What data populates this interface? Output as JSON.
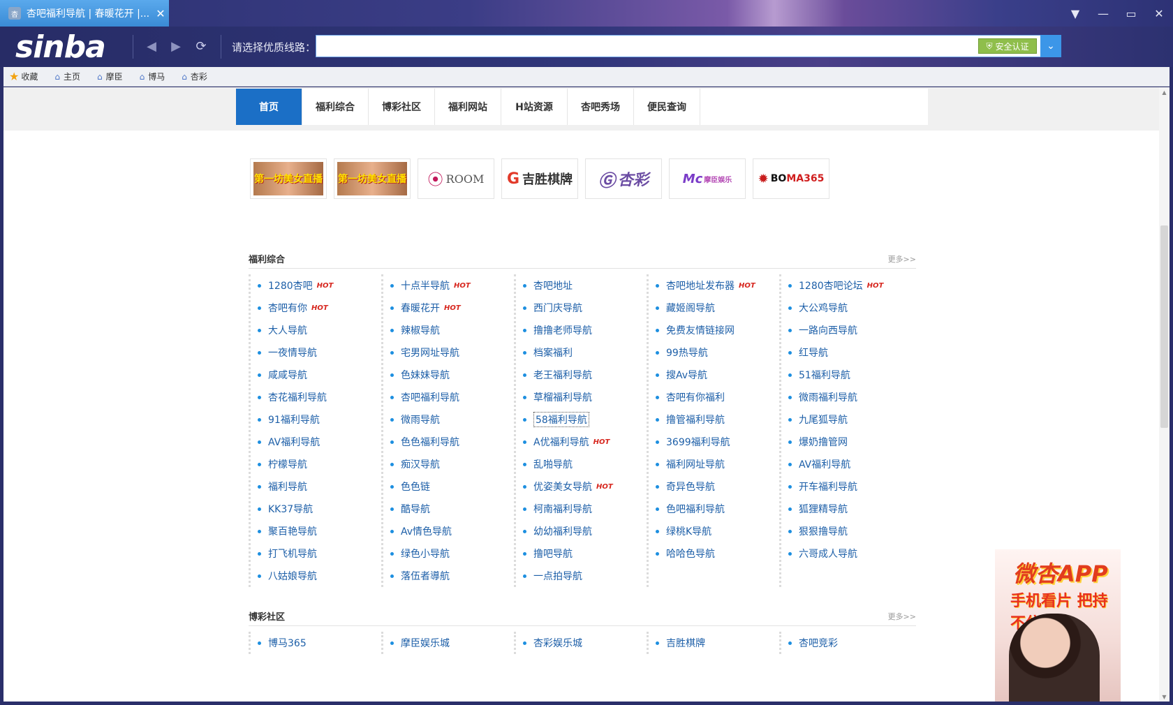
{
  "window": {
    "tab_title": "杏吧福利导航 | 春暖花开 |...",
    "favicon_text": "杏"
  },
  "browser": {
    "logo": "sinba",
    "line_label": "请选择优质线路：",
    "address_value": "",
    "secure_badge": "安全认证"
  },
  "favorites": [
    {
      "label": "收藏",
      "icon": "star-icon"
    },
    {
      "label": "主页",
      "icon": "home-icon"
    },
    {
      "label": "摩臣",
      "icon": "home-icon"
    },
    {
      "label": "博马",
      "icon": "home-icon"
    },
    {
      "label": "杏彩",
      "icon": "home-icon"
    }
  ],
  "nav": [
    "首页",
    "福利综合",
    "博彩社区",
    "福利网站",
    "H站资源",
    "杏吧秀场",
    "便民查询"
  ],
  "ads": {
    "live1": "第一坊美女直播",
    "live2": "第一坊美女直播",
    "room": "ROOM",
    "jisheng": "吉胜棋牌",
    "xingcai": "杏彩",
    "mochen": "摩臣娱乐",
    "boma_a": "BO",
    "boma_b": "MA365"
  },
  "section1": {
    "title": "福利综合",
    "more": "更多>>",
    "hot_label": "HOT",
    "columns": [
      [
        {
          "t": "1280杏吧",
          "hot": true
        },
        {
          "t": "杏吧有你",
          "hot": true
        },
        {
          "t": "大人导航"
        },
        {
          "t": "一夜情导航"
        },
        {
          "t": "咸咸导航"
        },
        {
          "t": "杏花福利导航"
        },
        {
          "t": "91福利导航"
        },
        {
          "t": "AV福利导航"
        },
        {
          "t": "柠檬导航"
        },
        {
          "t": "福利导航"
        },
        {
          "t": "KK37导航"
        },
        {
          "t": "聚百艳导航"
        },
        {
          "t": "打飞机导航"
        },
        {
          "t": "八姑娘导航"
        }
      ],
      [
        {
          "t": "十点半导航",
          "hot": true
        },
        {
          "t": "春暖花开",
          "hot": true
        },
        {
          "t": "辣椒导航"
        },
        {
          "t": "宅男网址导航"
        },
        {
          "t": "色妹妹导航"
        },
        {
          "t": "杏吧福利导航"
        },
        {
          "t": "微雨导航"
        },
        {
          "t": "色色福利导航"
        },
        {
          "t": "痴汉导航"
        },
        {
          "t": "色色链"
        },
        {
          "t": "酷导航"
        },
        {
          "t": "Av情色导航"
        },
        {
          "t": "绿色小导航"
        },
        {
          "t": "落伍者導航"
        }
      ],
      [
        {
          "t": "杏吧地址"
        },
        {
          "t": "西门庆导航"
        },
        {
          "t": "撸撸老师导航"
        },
        {
          "t": "档案福利"
        },
        {
          "t": "老王福利导航"
        },
        {
          "t": "草榴福利导航"
        },
        {
          "t": "58福利导航",
          "focused": true
        },
        {
          "t": "A优福利导航",
          "hot": true
        },
        {
          "t": "乱啪导航"
        },
        {
          "t": "优姿美女导航",
          "hot": true
        },
        {
          "t": "柯南福利导航"
        },
        {
          "t": "幼幼福利导航"
        },
        {
          "t": "撸吧导航"
        },
        {
          "t": "一点拍导航"
        }
      ],
      [
        {
          "t": "杏吧地址发布器",
          "hot": true
        },
        {
          "t": "藏姬阁导航"
        },
        {
          "t": "免费友情链接网"
        },
        {
          "t": "99热导航"
        },
        {
          "t": "搜Av导航"
        },
        {
          "t": "杏吧有你福利"
        },
        {
          "t": "撸管福利导航"
        },
        {
          "t": "3699福利导航"
        },
        {
          "t": "福利网址导航"
        },
        {
          "t": "奇异色导航"
        },
        {
          "t": "色吧福利导航"
        },
        {
          "t": "绿桃K导航"
        },
        {
          "t": "哈哈色导航"
        }
      ],
      [
        {
          "t": "1280杏吧论坛",
          "hot": true
        },
        {
          "t": "大公鸡导航"
        },
        {
          "t": "一路向西导航"
        },
        {
          "t": "红导航"
        },
        {
          "t": "51福利导航"
        },
        {
          "t": "微雨福利导航"
        },
        {
          "t": "九尾狐导航"
        },
        {
          "t": "爆奶撸管网"
        },
        {
          "t": "AV福利导航"
        },
        {
          "t": "开车福利导航"
        },
        {
          "t": "狐狸精导航"
        },
        {
          "t": "狠狠撸导航"
        },
        {
          "t": "六哥成人导航"
        }
      ]
    ]
  },
  "section2": {
    "title": "博彩社区",
    "more": "更多>>",
    "links": [
      "博马365",
      "摩臣娱乐城",
      "杏彩娱乐城",
      "吉胜棋牌",
      "杏吧竞彩"
    ]
  },
  "side_ad": {
    "line1": "微杏APP",
    "line2": "手机看片 把持不住"
  }
}
